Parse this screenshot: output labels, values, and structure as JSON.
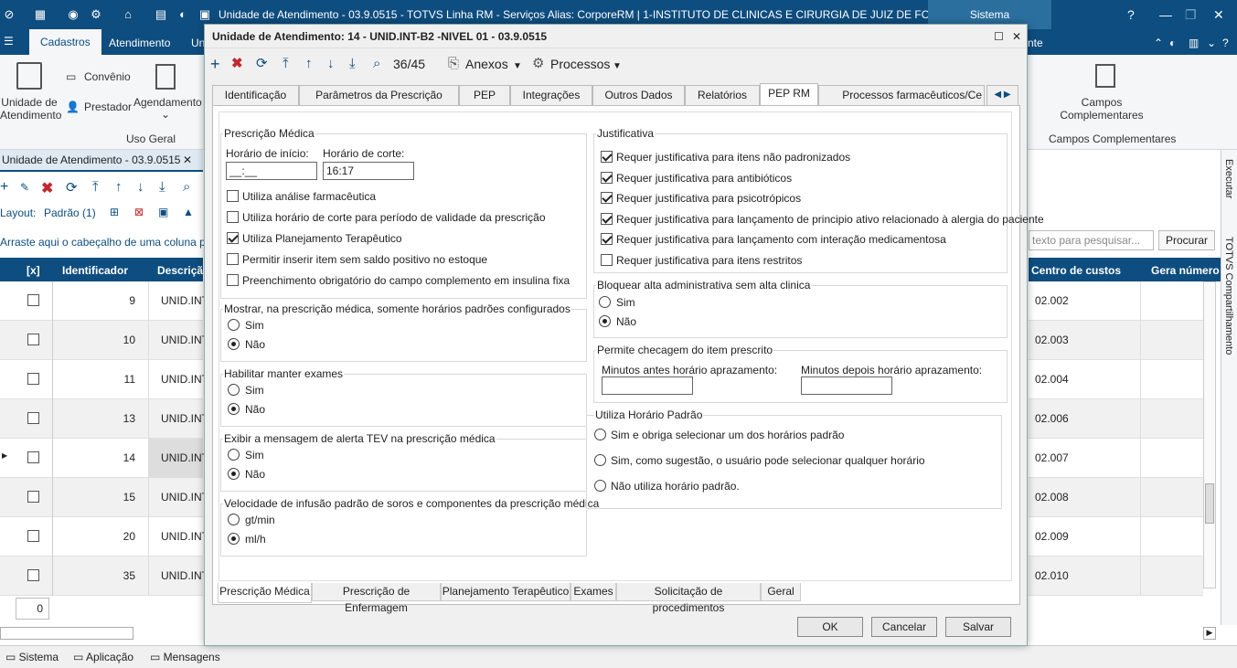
{
  "app": {
    "title": "Unidade de Atendimento - 03.9.0515 - TOTVS Linha RM - Serviços  Alias: CorporeRM | 1-INSTITUTO DE CLINICAS E CIRURGIA DE JUIZ DE FORA LTDA",
    "system_label": "Sistema"
  },
  "ribbon": {
    "tabs": [
      "Cadastros",
      "Atendimento",
      "Un",
      "nte"
    ],
    "items": {
      "unidade": "Unidade de Atendimento",
      "convenio": "Convênio",
      "prestador": "Prestador",
      "agendamento": "Agendamento",
      "campos": "Campos Complementares"
    },
    "groups": {
      "uso_geral": "Uso Geral",
      "campos_complementares": "Campos Complementares"
    }
  },
  "left": {
    "doc_tab": "Unidade de Atendimento - 03.9.0515",
    "layout_label": "Layout:",
    "layout_value": "Padrão (1)",
    "drag_hint": "Arraste aqui o cabeçalho de uma coluna para",
    "headers": {
      "check": "[x]",
      "id": "Identificador",
      "desc": "Descriçã"
    },
    "rows": [
      {
        "id": "9",
        "desc": "UNID.INT"
      },
      {
        "id": "10",
        "desc": "UNID.INT"
      },
      {
        "id": "11",
        "desc": "UNID.INT"
      },
      {
        "id": "13",
        "desc": "UNID.INT"
      },
      {
        "id": "14",
        "desc": "UNID.INT"
      },
      {
        "id": "15",
        "desc": "UNID.INT"
      },
      {
        "id": "20",
        "desc": "UNID.INT"
      },
      {
        "id": "35",
        "desc": "UNID.INT"
      }
    ],
    "footer_count": "0"
  },
  "right": {
    "search_placeholder": "texto para pesquisar...",
    "search_button": "Procurar",
    "headers": {
      "centro": "Centro de custos",
      "gera": "Gera número"
    },
    "rows": [
      "02.002",
      "02.003",
      "02.004",
      "02.006",
      "02.007",
      "02.008",
      "02.009",
      "02.010"
    ],
    "side_tabs": [
      "Executar",
      "TOTVS Compartilhamento"
    ]
  },
  "statusbar": {
    "sistema": "Sistema",
    "aplicacao": "Aplicação",
    "mensagens": "Mensagens"
  },
  "dialog": {
    "title": "Unidade de Atendimento: 14 - UNID.INT-B2 -NIVEL 01 - 03.9.0515",
    "record_counter": "36/45",
    "anexos": "Anexos",
    "processos": "Processos",
    "tabs": [
      "Identificação",
      "Parâmetros da Prescrição",
      "PEP",
      "Integrações",
      "Outros Dados",
      "Relatórios",
      "PEP RM",
      "Processos farmacêuticos/Ce"
    ],
    "prescricao": {
      "title": "Prescrição Médica",
      "inicio_label": "Horário de início:",
      "inicio_value": "__:__",
      "corte_label": "Horário de corte:",
      "corte_value": "16:17",
      "checks": [
        {
          "label": "Utiliza análise farmacêutica",
          "checked": false
        },
        {
          "label": "Utiliza horário de corte para período de validade da prescrição",
          "checked": false
        },
        {
          "label": "Utiliza Planejamento Terapêutico",
          "checked": true
        },
        {
          "label": "Permitir inserir item sem saldo positivo no estoque",
          "checked": false
        },
        {
          "label": "Preenchimento obrigatório do campo complemento em insulina fixa",
          "checked": false
        }
      ]
    },
    "mostrar": {
      "title": "Mostrar, na prescrição médica, somente horários padrões configurados",
      "sim": "Sim",
      "nao": "Não",
      "selected": "nao"
    },
    "exames": {
      "title": "Habilitar manter exames",
      "sim": "Sim",
      "nao": "Não",
      "selected": "nao"
    },
    "tev": {
      "title": "Exibir a mensagem de alerta TEV na prescrição médica",
      "sim": "Sim",
      "nao": "Não",
      "selected": "nao"
    },
    "infusao": {
      "title": "Velocidade de infusão padrão de soros e componentes da prescrição médica",
      "opt1": "gt/min",
      "opt2": "ml/h",
      "selected": "opt2"
    },
    "justificativa": {
      "title": "Justificativa",
      "checks": [
        {
          "label": "Requer justificativa para itens não padronizados",
          "checked": true
        },
        {
          "label": "Requer justificativa para antibióticos",
          "checked": true
        },
        {
          "label": "Requer justificativa para psicotrópicos",
          "checked": true
        },
        {
          "label": "Requer justificativa para lançamento de principio ativo relacionado à alergia do paciente",
          "checked": true
        },
        {
          "label": "Requer justificativa para lançamento com interação medicamentosa",
          "checked": true
        },
        {
          "label": "Requer justificativa para itens restritos",
          "checked": false
        }
      ]
    },
    "bloquear": {
      "title": "Bloquear alta administrativa sem alta clinica",
      "sim": "Sim",
      "nao": "Não",
      "selected": "nao"
    },
    "checagem": {
      "title": "Permite checagem do item prescrito",
      "antes": "Minutos antes horário aprazamento:",
      "depois": "Minutos depois horário aprazamento:"
    },
    "horario_padrao": {
      "title": "Utiliza Horário Padrão",
      "opt1": "Sim e obriga selecionar um dos horários padrão",
      "opt2": "Sim, como sugestão, o usuário pode selecionar qualquer horário",
      "opt3": "Não utiliza horário padrão."
    },
    "subtabs": [
      "Prescrição Médica",
      "Prescrição de Enfermagem",
      "Planejamento Terapêutico",
      "Exames",
      "Solicitação de procedimentos",
      "Geral"
    ],
    "buttons": {
      "ok": "OK",
      "cancelar": "Cancelar",
      "salvar": "Salvar"
    }
  }
}
